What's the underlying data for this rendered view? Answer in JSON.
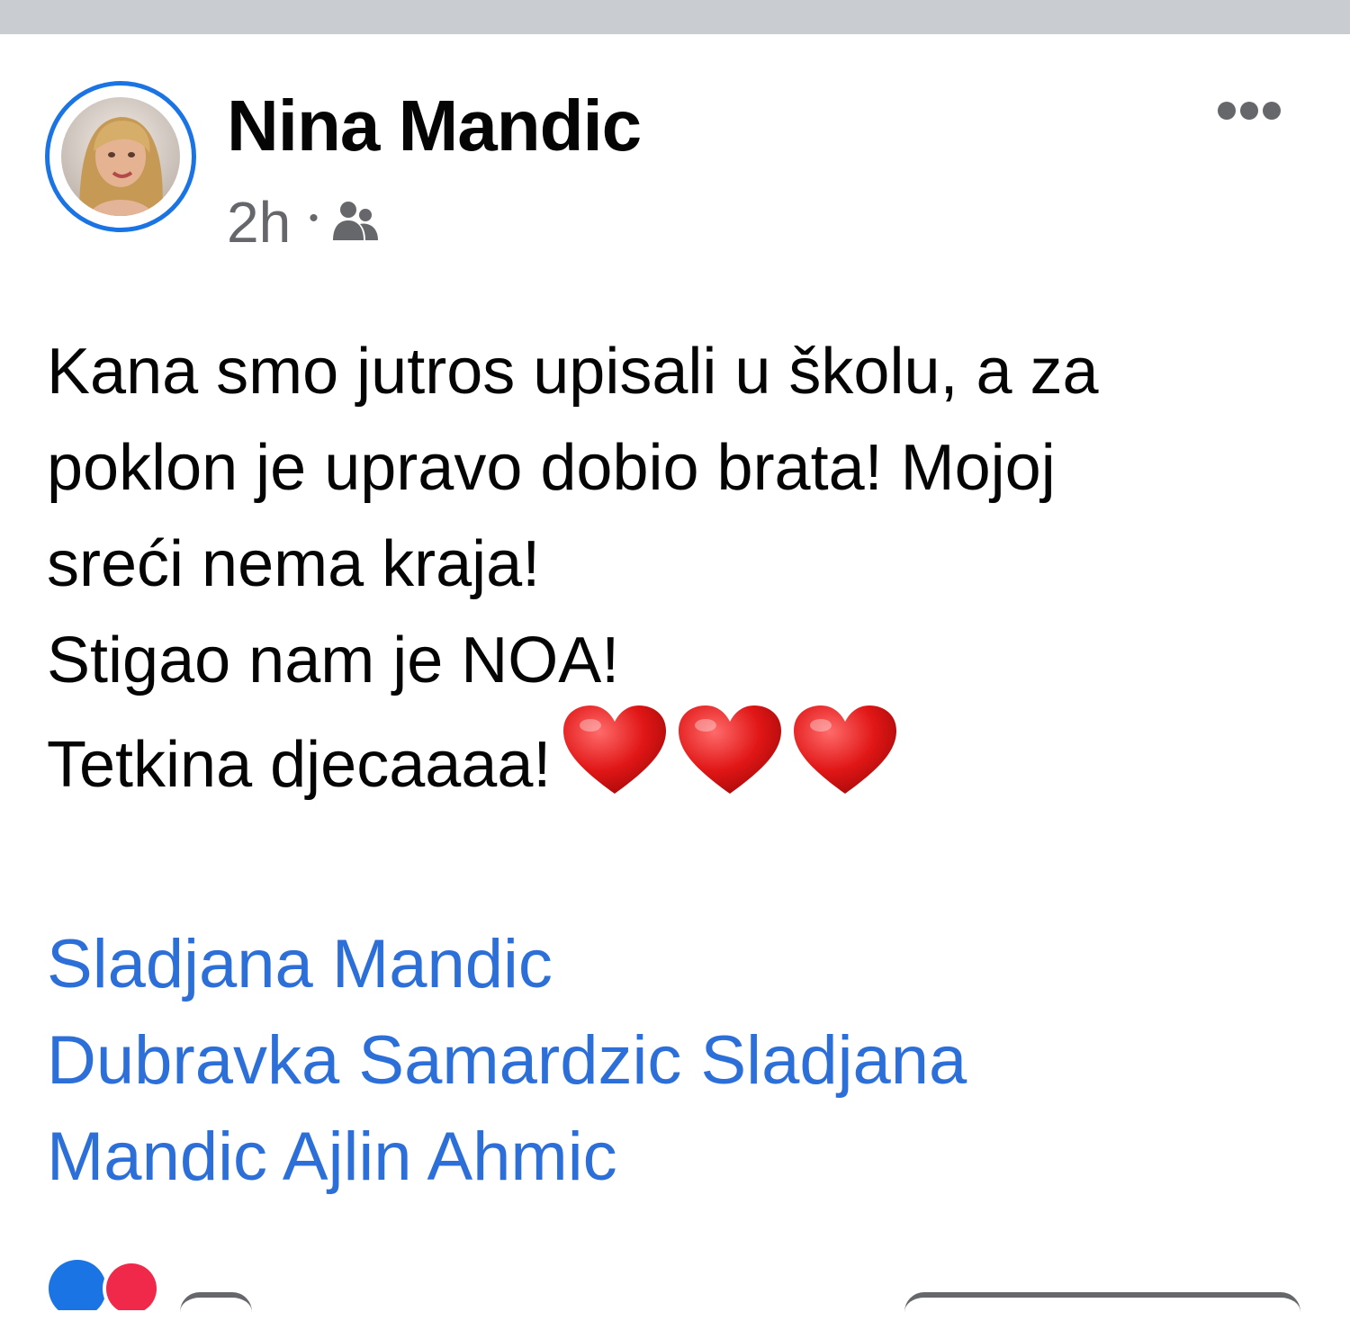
{
  "post": {
    "author": "Nina Mandic",
    "time": "2h",
    "separator": "•",
    "audience_icon": "friends-icon",
    "more_icon": "more-options-icon",
    "text_lines": [
      "Kana smo jutros upisali u školu, a za",
      "poklon je upravo dobio brata! Mojoj",
      "sreći nema kraja!",
      "Stigao nam je NOA!",
      "Tetkina djecaaaa!"
    ],
    "emoji": [
      "❤️",
      "❤️",
      "❤️"
    ],
    "tag_lines": [
      "Sladjana Mandic",
      "Dubravka Samardzic Sladjana",
      "Mandic Ajlin Ahmic"
    ]
  },
  "colors": {
    "link": "#2d6fd9",
    "ring": "#1b74e4",
    "text": "#050505",
    "secondary": "#65676b",
    "divider": "#c9ccd1"
  }
}
